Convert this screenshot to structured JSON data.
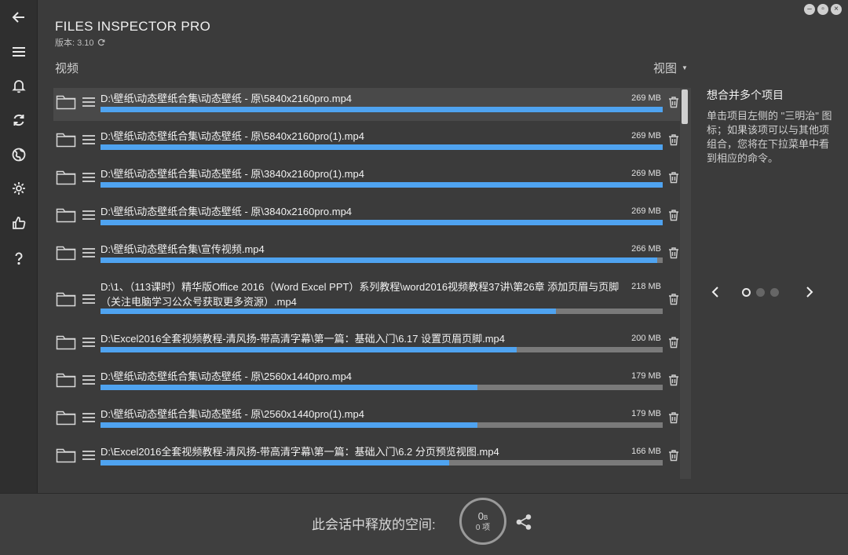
{
  "app": {
    "title": "FILES INSPECTOR PRO",
    "version": "版本: 3.10"
  },
  "rail": {
    "icons": [
      "back-arrow-icon",
      "hamburger-menu-icon",
      "bell-icon",
      "refresh-icon",
      "globe-icon",
      "gear-icon",
      "thumbs-up-icon",
      "help-icon"
    ]
  },
  "window_controls": [
    "minimize",
    "restore",
    "close"
  ],
  "section": {
    "label": "视频",
    "view_label": "视图"
  },
  "files": [
    {
      "path": "D:\\壁纸\\动态壁纸合集\\动态壁纸 - 原\\5840x2160pro.mp4",
      "size": "269 MB",
      "fraction": 1.0,
      "selected": true
    },
    {
      "path": "D:\\壁纸\\动态壁纸合集\\动态壁纸 - 原\\5840x2160pro(1).mp4",
      "size": "269 MB",
      "fraction": 1.0
    },
    {
      "path": "D:\\壁纸\\动态壁纸合集\\动态壁纸 - 原\\3840x2160pro(1).mp4",
      "size": "269 MB",
      "fraction": 1.0
    },
    {
      "path": "D:\\壁纸\\动态壁纸合集\\动态壁纸 - 原\\3840x2160pro.mp4",
      "size": "269 MB",
      "fraction": 1.0
    },
    {
      "path": "D:\\壁纸\\动态壁纸合集\\宣传视频.mp4",
      "size": "266 MB",
      "fraction": 0.99
    },
    {
      "path": "D:\\1、（113课时）精华版Office 2016（Word Excel PPT）系列教程\\word2016视频教程37讲\\第26章 添加页眉与页脚（关注电脑学习公众号获取更多资源）.mp4",
      "size": "218 MB",
      "fraction": 0.81,
      "wrap": true
    },
    {
      "path": "D:\\Excel2016全套视频教程-清风扬-带高清字幕\\第一篇：基础入门\\6.17 设置页眉页脚.mp4",
      "size": "200 MB",
      "fraction": 0.74
    },
    {
      "path": "D:\\壁纸\\动态壁纸合集\\动态壁纸 - 原\\2560x1440pro.mp4",
      "size": "179 MB",
      "fraction": 0.67
    },
    {
      "path": "D:\\壁纸\\动态壁纸合集\\动态壁纸 - 原\\2560x1440pro(1).mp4",
      "size": "179 MB",
      "fraction": 0.67
    },
    {
      "path": "D:\\Excel2016全套视频教程-清风扬-带高清字幕\\第一篇：基础入门\\6.2 分页预览视图.mp4",
      "size": "166 MB",
      "fraction": 0.62
    }
  ],
  "tip": {
    "title": "想合并多个项目",
    "body": "单击项目左侧的 \"三明治\" 图标；如果该项可以与其他项组合，您将在下拉菜单中看到相应的命令。",
    "page_count": 3,
    "active_page": 1
  },
  "footer": {
    "label": "此会话中释放的空间:",
    "freed_value": "0",
    "freed_unit": "B",
    "items": "0 项"
  },
  "colors": {
    "background": "#3b3b3b",
    "rail": "#2f2f2f",
    "accent_bar": "#4fa3f0",
    "bar_track": "#7a7a7a"
  }
}
